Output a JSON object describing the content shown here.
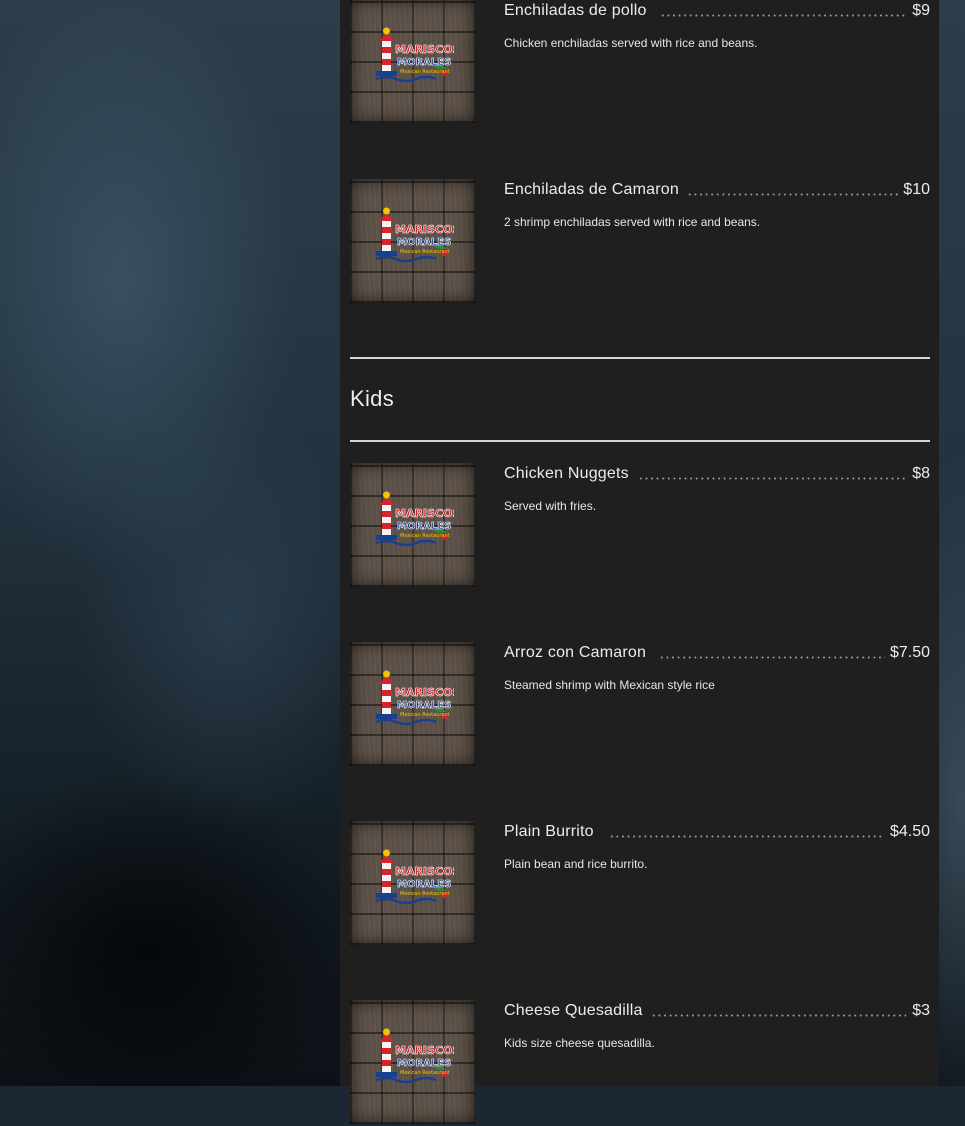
{
  "restaurant_logo": {
    "line1": "MARISCOS",
    "line2": "MORALES",
    "line3": "Mexican Restaurant"
  },
  "menu": {
    "top_items": [
      {
        "name": "Enchiladas de pollo",
        "price": "$9",
        "description": "Chicken enchiladas served with rice and beans."
      },
      {
        "name": "Enchiladas de Camaron",
        "price": "$10",
        "description": "2 shrimp enchiladas served with rice and beans."
      }
    ],
    "kids_section": {
      "title": "Kids",
      "items": [
        {
          "name": "Chicken Nuggets",
          "price": "$8",
          "description": "Served with fries."
        },
        {
          "name": "Arroz con Camaron",
          "price": "$7.50",
          "description": "Steamed shrimp with Mexican style rice"
        },
        {
          "name": "Plain Burrito",
          "price": "$4.50",
          "description": "Plain bean and rice burrito."
        },
        {
          "name": "Cheese Quesadilla",
          "price": "$3",
          "description": "Kids size cheese quesadilla."
        }
      ]
    }
  },
  "colors": {
    "panel": "#1f1f1f",
    "text": "#ececec",
    "logo_red": "#d8232a",
    "logo_yellow": "#f5c400",
    "logo_blue": "#1b3f8f"
  }
}
